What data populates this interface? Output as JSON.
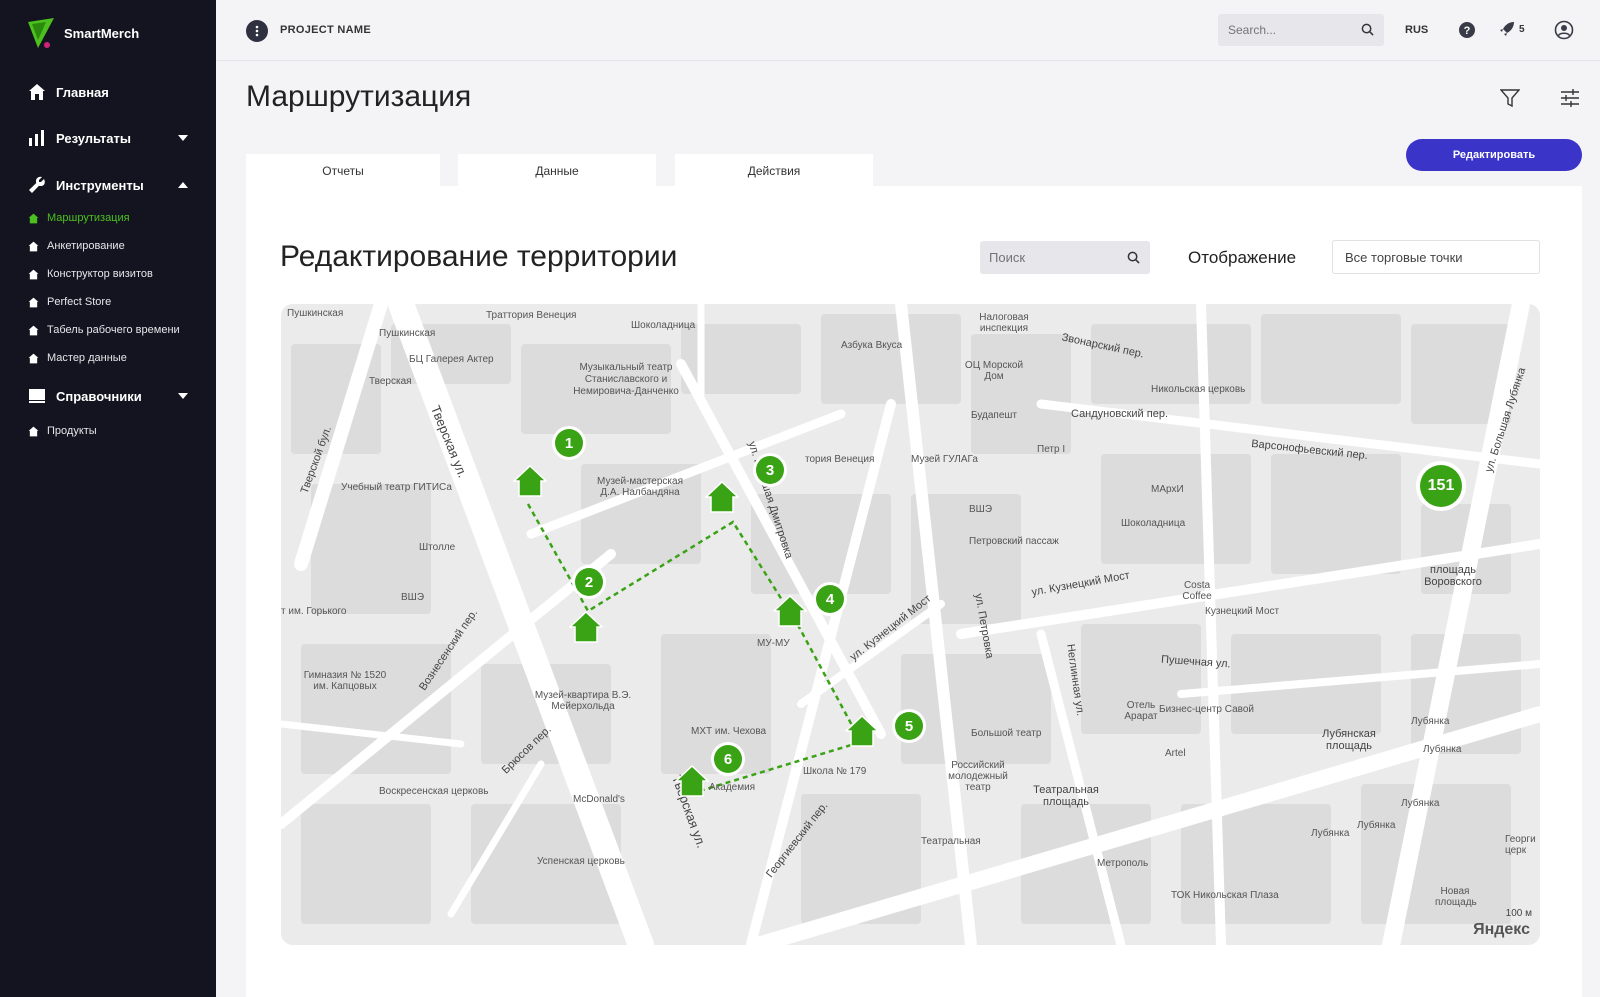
{
  "app": {
    "name": "SmartMerch"
  },
  "topbar": {
    "project_name": "PROJECT NAME",
    "search_placeholder": "Search...",
    "language": "RUS",
    "notifications_count": "5"
  },
  "sidebar": {
    "groups": [
      {
        "label": "Главная",
        "icon": "home-icon"
      },
      {
        "label": "Результаты",
        "icon": "bar-chart-icon"
      },
      {
        "label": "Инструменты",
        "icon": "wrench-icon"
      },
      {
        "label": "Справочники",
        "icon": "book-icon"
      }
    ],
    "tools_items": [
      {
        "label": "Маршрутизация",
        "active": true
      },
      {
        "label": "Анкетирование"
      },
      {
        "label": "Конструктор визитов"
      },
      {
        "label": "Perfect Store"
      },
      {
        "label": "Табель рабочего времени"
      },
      {
        "label": "Мастер данные"
      }
    ],
    "reference_items": [
      {
        "label": "Продукты"
      }
    ]
  },
  "page": {
    "title": "Маршрутизация",
    "edit_button": "Редактировать",
    "tabs": [
      {
        "label": "Отчеты"
      },
      {
        "label": "Данные"
      },
      {
        "label": "Действия"
      }
    ]
  },
  "territory": {
    "title": "Редактирование территории",
    "search_placeholder": "Поиск",
    "display_label": "Отображение",
    "display_value": "Все торговые точки"
  },
  "map": {
    "route_points": [
      "1",
      "2",
      "3",
      "4",
      "5",
      "6"
    ],
    "cluster_count": "151",
    "scale_label": "100 м",
    "provider": "Яндекс",
    "labels": {
      "street_tverskaya": "Тверская ул.",
      "street_tverskaya2": "Тверская ул.",
      "street_petrovka": "ул. Петровка",
      "street_neglinnaya": "Неглинная ул.",
      "street_kuz_most": "ул. Кузнецкий Мост",
      "street_kuz_most2": "ул. Кузнецкий Мост",
      "street_pushechnaya": "Пушечная ул.",
      "street_varsonof": "Варсонофьевский пер.",
      "street_sandun": "Сандуновский пер.",
      "street_zvonar": "Звонарский пер.",
      "street_bolsh_lub": "ул. Большая Лубянка",
      "street_georg": "Георгиевский пер.",
      "street_bryusov": "Брюсов пер.",
      "street_voznes": "Вознесенский пер.",
      "street_tver_blvd": "Тверской бул.",
      "street_kamerg": "ул. Большая Дмитровка",
      "theatre_square": "Театральная площадь",
      "lubyanka_square": "Лубянская площадь",
      "vorovsky_square": "площадь Воровского",
      "pushkinskaya": "Пушкинская",
      "tverskaya_metro": "Тверская",
      "pushkinskaya2": "Пушкинская",
      "galleria": "БЦ Галерея Актер",
      "trattoria": "Траттория Венеция",
      "shokoladnitsa": "Шоколадница",
      "music_theatre": "Музыкальный театр Станиславского и Немировича-Данченко",
      "azbuka": "Азбука Вкуса",
      "gulag": "Музей ГУЛАГа",
      "sea_house": "ОЦ Морской Дом",
      "budapest": "Будапешт",
      "gitis": "Учебный театр ГИТИСа",
      "museum_nalb": "Музей-мастерская Д.А. Налбандяна",
      "shtolle": "Штолле",
      "vshe": "ВШЭ",
      "vshe2": "ВШЭ",
      "gorky": "т им. Горького",
      "gymnasium": "Гимназия № 1520 им. Капцовых",
      "meyerhold": "Музей-квартира В.Э. Мейерхольда",
      "mu_mu": "МУ-МУ",
      "mkhat": "МХТ им. Чехова",
      "school": "Школа № 179",
      "academy": "Академия",
      "mcdonalds": "McDonald's",
      "voskres": "Воскресенская церковь",
      "uspensk": "Успенская церковь",
      "bolshoi": "Большой театр",
      "ramt": "Российский молодежный театр",
      "teatralnaya": "Театральная",
      "metropol": "Метрополь",
      "tok": "ТОК Никольская Плаза",
      "petrovsky": "Петровский пассаж",
      "marhi": "МАрхИ",
      "shokoladnitsa2": "Шоколадница",
      "costa": "Costa Coffee",
      "kuz_most_metro": "Кузнецкий Мост",
      "ararat": "Отель Арарат",
      "savoy": "Бизнес-центр Савой",
      "artel": "Artel",
      "lubyanka1": "Лубянка",
      "lubyanka2": "Лубянка",
      "lubyanka3": "Лубянка",
      "lubyanka4": "Лубянка",
      "lubyanka5": "Лубянка",
      "nikolsk": "Никольская церковь",
      "nalog": "Налоговая инспекция",
      "petr": "Петр I",
      "venice2": "тория Венеция",
      "novaya": "Новая площадь",
      "georg2": "Георги церк"
    }
  },
  "colors": {
    "sidebar_bg": "#13141f",
    "accent_green": "#4bc01e",
    "route_green": "#3aa315",
    "primary_button": "#3b34c9"
  }
}
